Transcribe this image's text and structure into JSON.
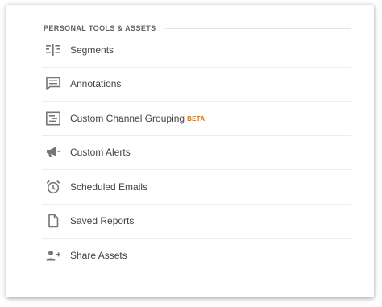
{
  "panel": {
    "section_title": "PERSONAL TOOLS & ASSETS",
    "items": [
      {
        "label": "Segments",
        "icon": "segments-icon"
      },
      {
        "label": "Annotations",
        "icon": "annotations-icon"
      },
      {
        "label": "Custom Channel Grouping",
        "icon": "channel-grouping-icon",
        "badge": "BETA",
        "badge_color": "#e37400"
      },
      {
        "label": "Custom Alerts",
        "icon": "megaphone-icon"
      },
      {
        "label": "Scheduled Emails",
        "icon": "alarm-clock-icon"
      },
      {
        "label": "Saved Reports",
        "icon": "document-icon"
      },
      {
        "label": "Share Assets",
        "icon": "add-person-icon"
      }
    ]
  },
  "colors": {
    "icon": "#757575",
    "text": "#424242",
    "header": "#616161",
    "badge": "#e37400",
    "divider": "#ececec"
  }
}
